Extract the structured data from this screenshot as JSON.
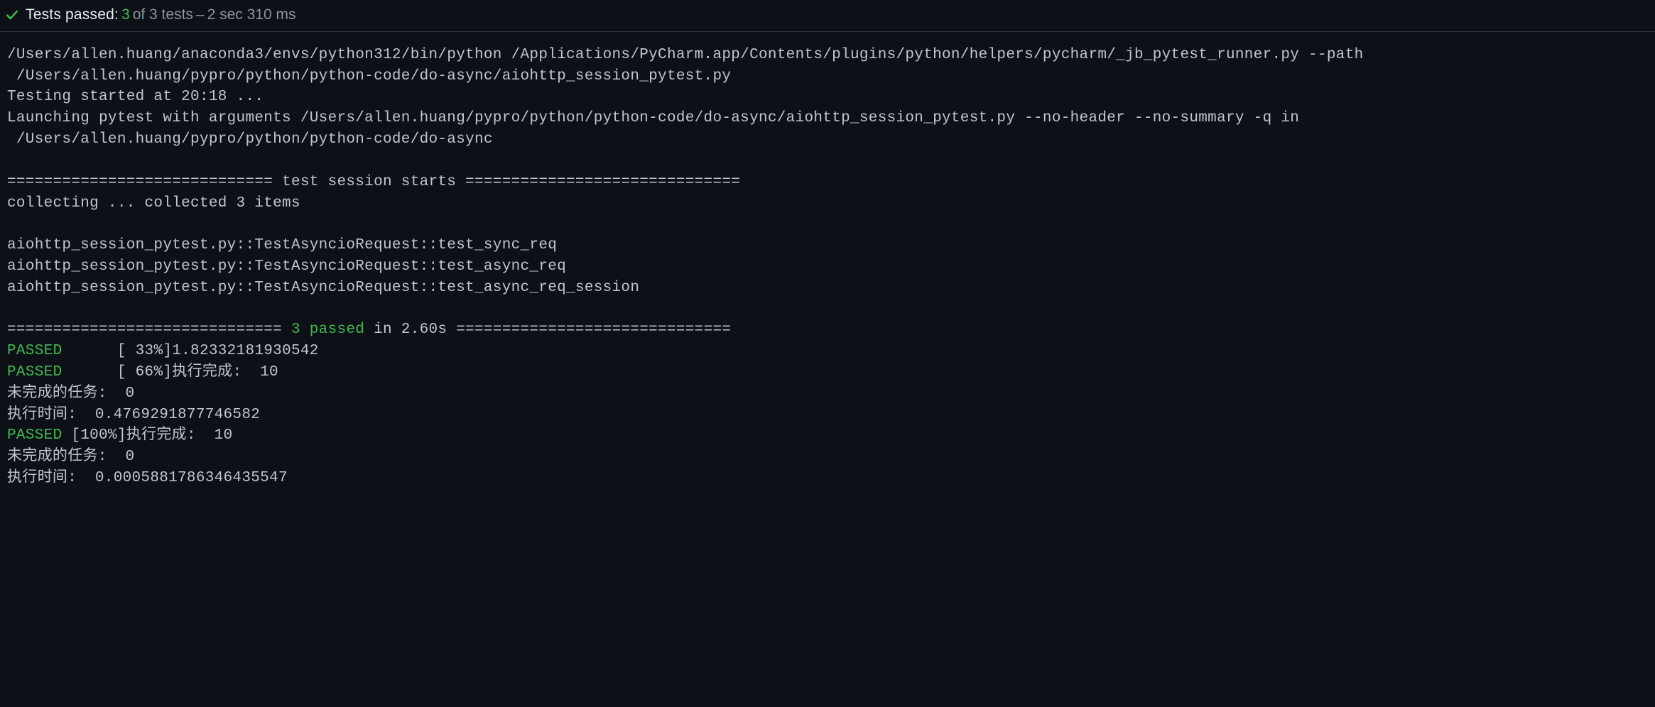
{
  "header": {
    "label": "Tests passed:",
    "count": "3",
    "of_suffix": "of 3 tests",
    "dash": "–",
    "time": "2 sec 310 ms",
    "icon_name": "check-icon"
  },
  "console": {
    "line1": "/Users/allen.huang/anaconda3/envs/python312/bin/python /Applications/PyCharm.app/Contents/plugins/python/helpers/pycharm/_jb_pytest_runner.py --path",
    "line2": " /Users/allen.huang/pypro/python/python-code/do-async/aiohttp_session_pytest.py",
    "line3": "Testing started at 20:18 ...",
    "line4": "Launching pytest with arguments /Users/allen.huang/pypro/python/python-code/do-async/aiohttp_session_pytest.py --no-header --no-summary -q in",
    "line5": " /Users/allen.huang/pypro/python/python-code/do-async",
    "line_blank": "",
    "session_starts": "============================= test session starts ==============================",
    "collecting": "collecting ... collected 3 items",
    "test1": "aiohttp_session_pytest.py::TestAsyncioRequest::test_sync_req ",
    "test2": "aiohttp_session_pytest.py::TestAsyncioRequest::test_async_req ",
    "test3": "aiohttp_session_pytest.py::TestAsyncioRequest::test_async_req_session ",
    "summary_prefix": "============================== ",
    "summary_mid": "3 passed",
    "summary_suffix": " in 2.60s ==============================",
    "r1a": "PASSED",
    "r1b": "      [ 33%]1.82332181930542",
    "r2a": "PASSED",
    "r2b": "      [ 66%]执行完成:  10",
    "r3": "未完成的任务:  0",
    "r4": "执行时间:  0.4769291877746582",
    "r5a": "PASSED",
    "r5b": " [100%]执行完成:  10",
    "r6": "未完成的任务:  0",
    "r7": "执行时间:  0.0005881786346435547"
  }
}
